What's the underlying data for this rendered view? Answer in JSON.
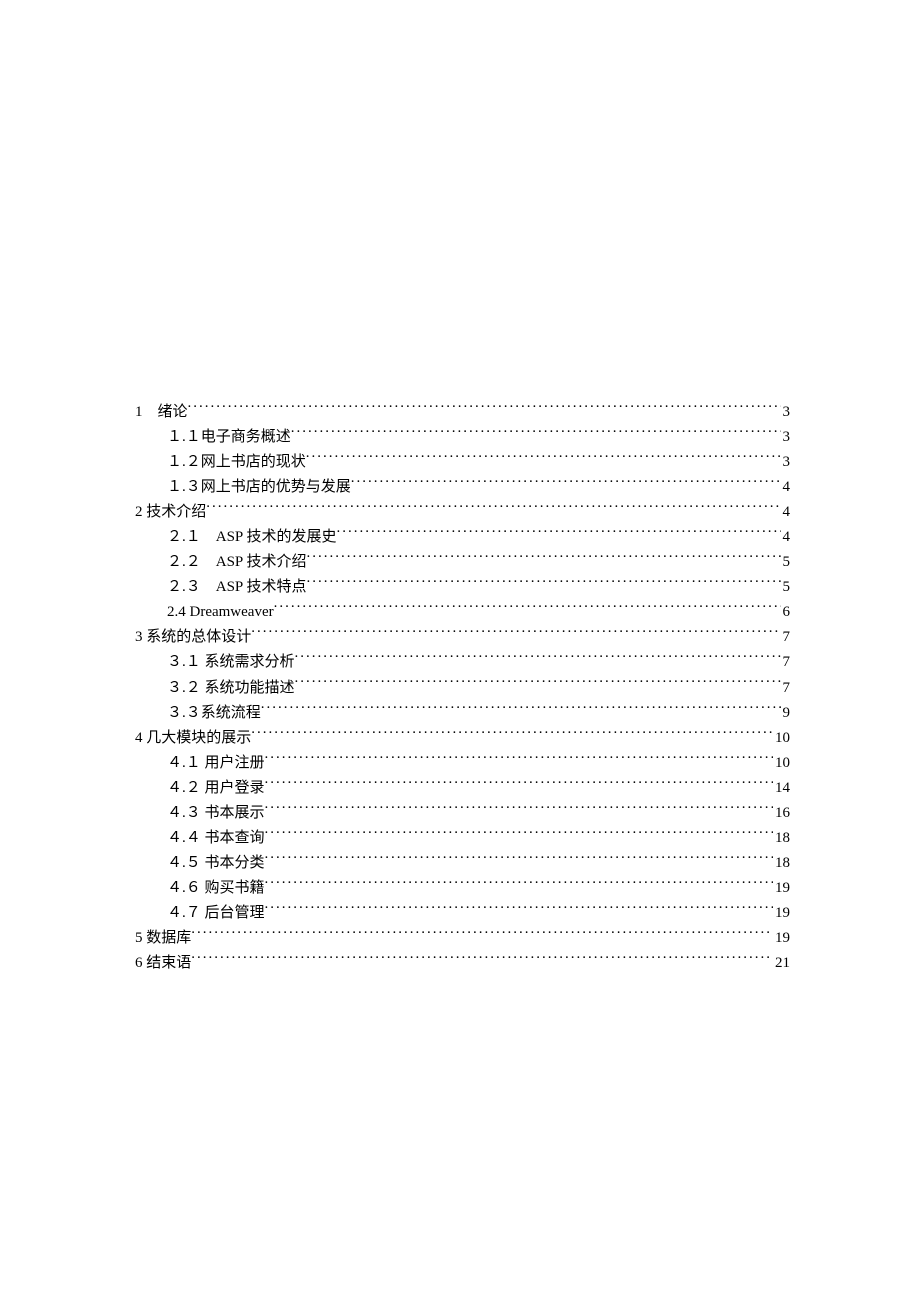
{
  "toc": [
    {
      "level": 0,
      "label": "1　绪论",
      "page": "3"
    },
    {
      "level": 1,
      "label": "１.１电子商务概述",
      "page": "3"
    },
    {
      "level": 1,
      "label": "１.２网上书店的现状",
      "page": "3"
    },
    {
      "level": 1,
      "label": "１.３网上书店的优势与发展",
      "page": "4"
    },
    {
      "level": 0,
      "label": "2 技术介绍",
      "page": "4"
    },
    {
      "level": 1,
      "label": "２.１　ASP 技术的发展史",
      "page": "4"
    },
    {
      "level": 1,
      "label": "２.２　ASP 技术介绍",
      "page": "5"
    },
    {
      "level": 1,
      "label": "２.３　ASP 技术特点",
      "page": "5"
    },
    {
      "level": 1,
      "label": "2.4 Dreamweaver ",
      "page": "6"
    },
    {
      "level": 0,
      "label": "3  系统的总体设计",
      "page": "7"
    },
    {
      "level": 1,
      "label": "３.１ 系统需求分析",
      "page": "7"
    },
    {
      "level": 1,
      "label": "３.２ 系统功能描述",
      "page": "7"
    },
    {
      "level": 1,
      "label": "３.３系统流程",
      "page": "9"
    },
    {
      "level": 0,
      "label": "4  几大模块的展示",
      "page": "10"
    },
    {
      "level": 1,
      "label": "４.１ 用户注册",
      "page": "10"
    },
    {
      "level": 1,
      "label": "４.２ 用户登录",
      "page": "14"
    },
    {
      "level": 1,
      "label": "４.３ 书本展示",
      "page": "16"
    },
    {
      "level": 1,
      "label": "４.４ 书本查询",
      "page": "18"
    },
    {
      "level": 1,
      "label": "４.５ 书本分类",
      "page": "18"
    },
    {
      "level": 1,
      "label": "４.６ 购买书籍",
      "page": "19"
    },
    {
      "level": 1,
      "label": "４.７ 后台管理",
      "page": "19"
    },
    {
      "level": 0,
      "label": "5  数据库",
      "page": "19"
    },
    {
      "level": 0,
      "label": "6 结束语",
      "page": "21"
    }
  ]
}
